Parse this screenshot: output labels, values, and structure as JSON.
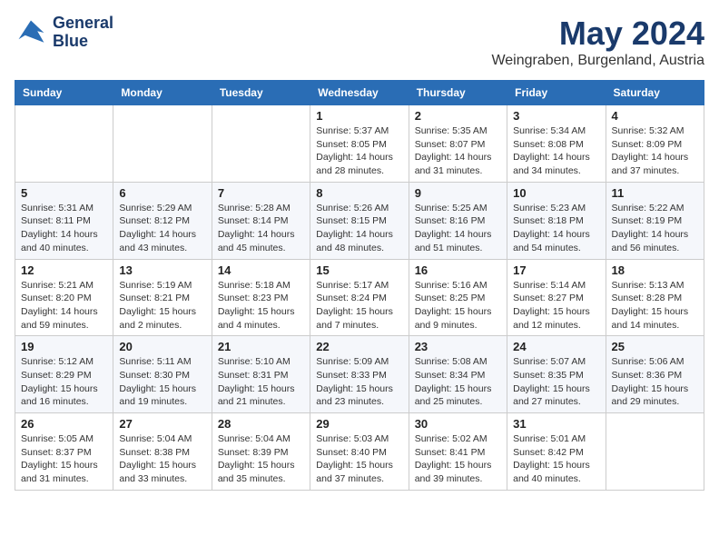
{
  "logo": {
    "line1": "General",
    "line2": "Blue"
  },
  "title": "May 2024",
  "location": "Weingraben, Burgenland, Austria",
  "days_of_week": [
    "Sunday",
    "Monday",
    "Tuesday",
    "Wednesday",
    "Thursday",
    "Friday",
    "Saturday"
  ],
  "weeks": [
    [
      {
        "day": "",
        "info": ""
      },
      {
        "day": "",
        "info": ""
      },
      {
        "day": "",
        "info": ""
      },
      {
        "day": "1",
        "info": "Sunrise: 5:37 AM\nSunset: 8:05 PM\nDaylight: 14 hours\nand 28 minutes."
      },
      {
        "day": "2",
        "info": "Sunrise: 5:35 AM\nSunset: 8:07 PM\nDaylight: 14 hours\nand 31 minutes."
      },
      {
        "day": "3",
        "info": "Sunrise: 5:34 AM\nSunset: 8:08 PM\nDaylight: 14 hours\nand 34 minutes."
      },
      {
        "day": "4",
        "info": "Sunrise: 5:32 AM\nSunset: 8:09 PM\nDaylight: 14 hours\nand 37 minutes."
      }
    ],
    [
      {
        "day": "5",
        "info": "Sunrise: 5:31 AM\nSunset: 8:11 PM\nDaylight: 14 hours\nand 40 minutes."
      },
      {
        "day": "6",
        "info": "Sunrise: 5:29 AM\nSunset: 8:12 PM\nDaylight: 14 hours\nand 43 minutes."
      },
      {
        "day": "7",
        "info": "Sunrise: 5:28 AM\nSunset: 8:14 PM\nDaylight: 14 hours\nand 45 minutes."
      },
      {
        "day": "8",
        "info": "Sunrise: 5:26 AM\nSunset: 8:15 PM\nDaylight: 14 hours\nand 48 minutes."
      },
      {
        "day": "9",
        "info": "Sunrise: 5:25 AM\nSunset: 8:16 PM\nDaylight: 14 hours\nand 51 minutes."
      },
      {
        "day": "10",
        "info": "Sunrise: 5:23 AM\nSunset: 8:18 PM\nDaylight: 14 hours\nand 54 minutes."
      },
      {
        "day": "11",
        "info": "Sunrise: 5:22 AM\nSunset: 8:19 PM\nDaylight: 14 hours\nand 56 minutes."
      }
    ],
    [
      {
        "day": "12",
        "info": "Sunrise: 5:21 AM\nSunset: 8:20 PM\nDaylight: 14 hours\nand 59 minutes."
      },
      {
        "day": "13",
        "info": "Sunrise: 5:19 AM\nSunset: 8:21 PM\nDaylight: 15 hours\nand 2 minutes."
      },
      {
        "day": "14",
        "info": "Sunrise: 5:18 AM\nSunset: 8:23 PM\nDaylight: 15 hours\nand 4 minutes."
      },
      {
        "day": "15",
        "info": "Sunrise: 5:17 AM\nSunset: 8:24 PM\nDaylight: 15 hours\nand 7 minutes."
      },
      {
        "day": "16",
        "info": "Sunrise: 5:16 AM\nSunset: 8:25 PM\nDaylight: 15 hours\nand 9 minutes."
      },
      {
        "day": "17",
        "info": "Sunrise: 5:14 AM\nSunset: 8:27 PM\nDaylight: 15 hours\nand 12 minutes."
      },
      {
        "day": "18",
        "info": "Sunrise: 5:13 AM\nSunset: 8:28 PM\nDaylight: 15 hours\nand 14 minutes."
      }
    ],
    [
      {
        "day": "19",
        "info": "Sunrise: 5:12 AM\nSunset: 8:29 PM\nDaylight: 15 hours\nand 16 minutes."
      },
      {
        "day": "20",
        "info": "Sunrise: 5:11 AM\nSunset: 8:30 PM\nDaylight: 15 hours\nand 19 minutes."
      },
      {
        "day": "21",
        "info": "Sunrise: 5:10 AM\nSunset: 8:31 PM\nDaylight: 15 hours\nand 21 minutes."
      },
      {
        "day": "22",
        "info": "Sunrise: 5:09 AM\nSunset: 8:33 PM\nDaylight: 15 hours\nand 23 minutes."
      },
      {
        "day": "23",
        "info": "Sunrise: 5:08 AM\nSunset: 8:34 PM\nDaylight: 15 hours\nand 25 minutes."
      },
      {
        "day": "24",
        "info": "Sunrise: 5:07 AM\nSunset: 8:35 PM\nDaylight: 15 hours\nand 27 minutes."
      },
      {
        "day": "25",
        "info": "Sunrise: 5:06 AM\nSunset: 8:36 PM\nDaylight: 15 hours\nand 29 minutes."
      }
    ],
    [
      {
        "day": "26",
        "info": "Sunrise: 5:05 AM\nSunset: 8:37 PM\nDaylight: 15 hours\nand 31 minutes."
      },
      {
        "day": "27",
        "info": "Sunrise: 5:04 AM\nSunset: 8:38 PM\nDaylight: 15 hours\nand 33 minutes."
      },
      {
        "day": "28",
        "info": "Sunrise: 5:04 AM\nSunset: 8:39 PM\nDaylight: 15 hours\nand 35 minutes."
      },
      {
        "day": "29",
        "info": "Sunrise: 5:03 AM\nSunset: 8:40 PM\nDaylight: 15 hours\nand 37 minutes."
      },
      {
        "day": "30",
        "info": "Sunrise: 5:02 AM\nSunset: 8:41 PM\nDaylight: 15 hours\nand 39 minutes."
      },
      {
        "day": "31",
        "info": "Sunrise: 5:01 AM\nSunset: 8:42 PM\nDaylight: 15 hours\nand 40 minutes."
      },
      {
        "day": "",
        "info": ""
      }
    ]
  ]
}
